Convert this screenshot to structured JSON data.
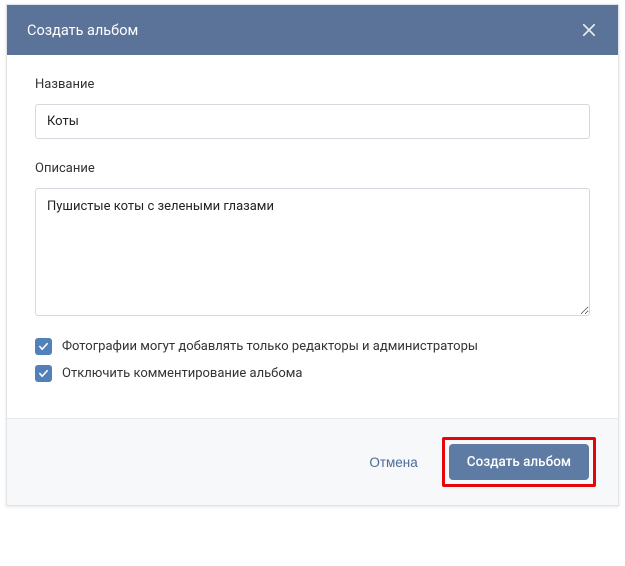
{
  "header": {
    "title": "Создать альбом"
  },
  "form": {
    "title_label": "Название",
    "title_value": "Коты",
    "description_label": "Описание",
    "description_value": "Пушистые коты с зелеными глазами",
    "checkbox1_label": "Фотографии могут добавлять только редакторы и администраторы",
    "checkbox2_label": "Отключить комментирование альбома"
  },
  "footer": {
    "cancel_label": "Отмена",
    "submit_label": "Создать альбом"
  }
}
